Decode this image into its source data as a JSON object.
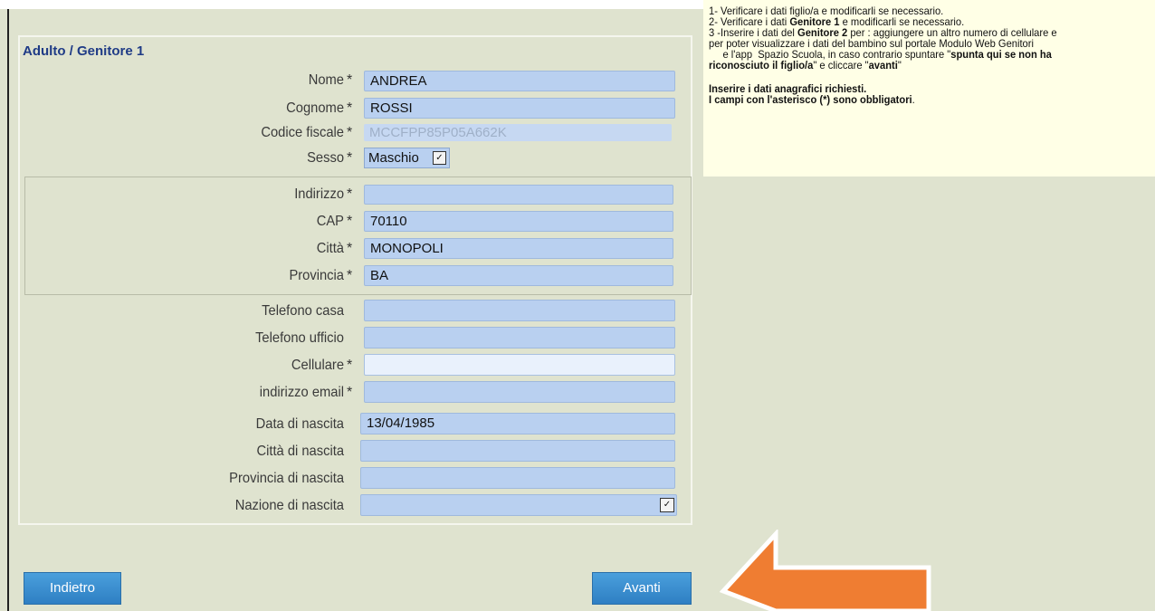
{
  "section": {
    "title": "Adulto / Genitore 1"
  },
  "fields": {
    "nome": {
      "label": "Nome",
      "required_mark": "*",
      "value": "ANDREA"
    },
    "cognome": {
      "label": "Cognome",
      "required_mark": "*",
      "value": "ROSSI"
    },
    "codice_fiscale": {
      "label": "Codice fiscale",
      "required_mark": "*",
      "value": "MCCFPP85P05A662K"
    },
    "sesso": {
      "label": "Sesso",
      "required_mark": "*",
      "value": "Maschio"
    },
    "indirizzo": {
      "label": "Indirizzo",
      "required_mark": "*",
      "value": ""
    },
    "cap": {
      "label": "CAP",
      "required_mark": "*",
      "value": "70110"
    },
    "citta": {
      "label": "Città",
      "required_mark": "*",
      "value": "MONOPOLI"
    },
    "provincia": {
      "label": "Provincia",
      "required_mark": "*",
      "value": "BA"
    },
    "telefono_casa": {
      "label": "Telefono casa",
      "value": ""
    },
    "telefono_ufficio": {
      "label": "Telefono ufficio",
      "value": ""
    },
    "cellulare": {
      "label": "Cellulare",
      "required_mark": "*",
      "value": ""
    },
    "email": {
      "label": "indirizzo email",
      "required_mark": "*",
      "value": ""
    },
    "data_nascita": {
      "label": "Data di nascita",
      "value": "13/04/1985"
    },
    "citta_nascita": {
      "label": "Città di nascita",
      "value": ""
    },
    "provincia_nascita": {
      "label": "Provincia di nascita",
      "value": ""
    },
    "nazione_nascita": {
      "label": "Nazione di nascita",
      "value": ""
    }
  },
  "info": {
    "line1": "1-  Verificare i dati figlio/a e modificarli se necessario.",
    "line2_a": "2-  Verificare i dati ",
    "line2_b": "Genitore 1",
    "line2_c": " e modificarli se necessario.",
    "line3_a": "3  -Inserire i dati del ",
    "line3_b": "Genitore 2",
    "line3_c": " per : aggiungere un altro numero di cellulare e",
    "line4": "per poter visualizzare i dati del bambino sul portale Modulo Web Genitori",
    "line5_a": "     e l'app  Spazio Scuola, in caso contrario spuntare \"",
    "line5_b": "spunta qui se non ha",
    "line6_a": "riconosciuto il figlio/a",
    "line6_b": "\" e cliccare \"",
    "line6_c": "avanti",
    "line6_d": "\"",
    "line7": "Inserire i dati anagrafici richiesti.",
    "line8_a": "I campi con l'asterisco (*) sono obbligatori",
    "line8_b": "."
  },
  "buttons": {
    "back": "Indietro",
    "next": "Avanti"
  },
  "colors": {
    "accent_button": "#3a8fd0",
    "arrow": "#ef7d32",
    "field": "#b9d0f0",
    "title": "#1f3b86"
  },
  "icons": {
    "select_chevron": "chevron-down-icon",
    "annotation_arrow": "arrow-left-icon"
  }
}
